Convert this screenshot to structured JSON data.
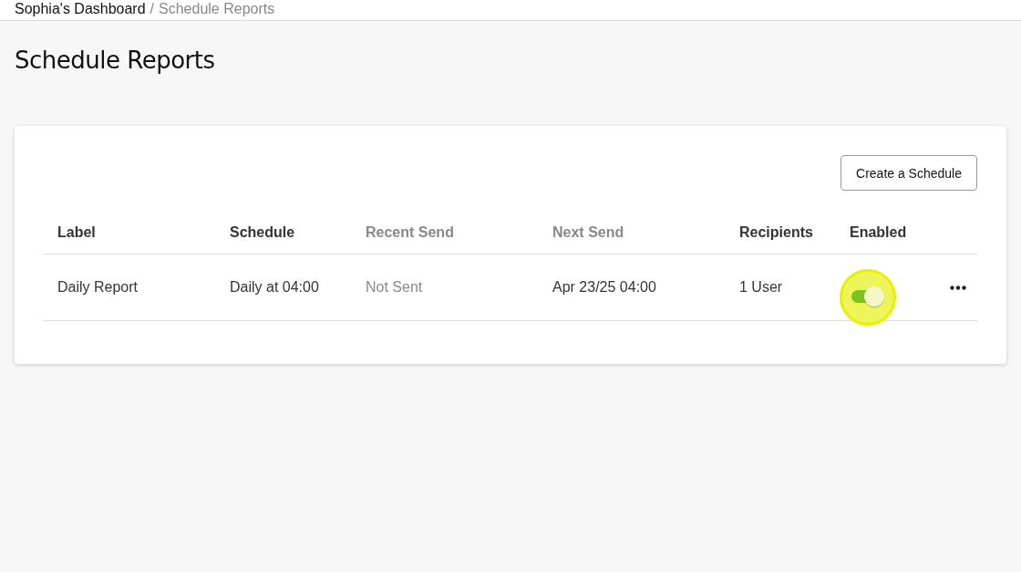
{
  "breadcrumb": {
    "parent": "Sophia's Dashboard",
    "separator": "/",
    "current": "Schedule Reports"
  },
  "page_title": "Schedule Reports",
  "create_button": "Create a Schedule",
  "table": {
    "columns": [
      {
        "label": "Label",
        "muted": false
      },
      {
        "label": "Schedule",
        "muted": false
      },
      {
        "label": "Recent Send",
        "muted": true
      },
      {
        "label": "Next Send",
        "muted": true
      },
      {
        "label": "Recipients",
        "muted": false
      },
      {
        "label": "Enabled",
        "muted": false
      }
    ],
    "rows": [
      {
        "cells": [
          {
            "text": "Daily Report",
            "muted": false
          },
          {
            "text": "Daily at 04:00",
            "muted": false
          },
          {
            "text": "Not Sent",
            "muted": true
          },
          {
            "text": "Apr 23/25 04:00",
            "muted": false
          },
          {
            "text": "1 User",
            "muted": false
          }
        ],
        "enabled": true,
        "click_highlight": true
      }
    ]
  }
}
